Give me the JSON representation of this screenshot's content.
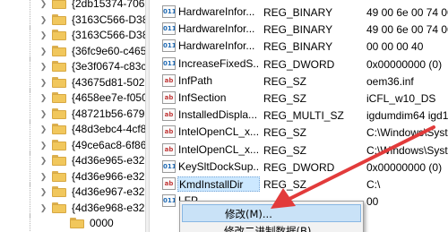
{
  "tree": {
    "items": [
      {
        "label": "{2db15374-706",
        "sub": false
      },
      {
        "label": "{3163C566-D38",
        "sub": false
      },
      {
        "label": "{3163C566-D38",
        "sub": false
      },
      {
        "label": "{36fc9e60-c465",
        "sub": false
      },
      {
        "label": "{3e3f0674-c83c",
        "sub": false
      },
      {
        "label": "{43675d81-502",
        "sub": false
      },
      {
        "label": "{4658ee7e-f050",
        "sub": false
      },
      {
        "label": "{48721b56-679",
        "sub": false
      },
      {
        "label": "{48d3ebc4-4cf8",
        "sub": false
      },
      {
        "label": "{49ce6ac8-6f86",
        "sub": false
      },
      {
        "label": "{4d36e965-e32",
        "sub": false
      },
      {
        "label": "{4d36e966-e32",
        "sub": false
      },
      {
        "label": "{4d36e967-e32",
        "sub": false
      },
      {
        "label": "{4d36e968-e32",
        "sub": false
      },
      {
        "label": "0000",
        "sub": true
      }
    ]
  },
  "values": {
    "rows": [
      {
        "name": "HardwareInfor...",
        "type": "REG_BINARY",
        "data": "49 00 6e 00 74 00",
        "icon": "bin"
      },
      {
        "name": "HardwareInfor...",
        "type": "REG_BINARY",
        "data": "49 00 6e 00 74 00",
        "icon": "bin"
      },
      {
        "name": "HardwareInfor...",
        "type": "REG_BINARY",
        "data": "00 00 00 40",
        "icon": "bin"
      },
      {
        "name": "IncreaseFixedS...",
        "type": "REG_DWORD",
        "data": "0x00000000 (0)",
        "icon": "bin"
      },
      {
        "name": "InfPath",
        "type": "REG_SZ",
        "data": "oem36.inf",
        "icon": "str"
      },
      {
        "name": "InfSection",
        "type": "REG_SZ",
        "data": "iCFL_w10_DS",
        "icon": "str"
      },
      {
        "name": "InstalledDispla...",
        "type": "REG_MULTI_SZ",
        "data": "igdumdim64 igd1",
        "icon": "str"
      },
      {
        "name": "IntelOpenCL_x...",
        "type": "REG_SZ",
        "data": "C:\\Windows\\Syste",
        "icon": "str"
      },
      {
        "name": "IntelOpenCL_x...",
        "type": "REG_SZ",
        "data": "C:\\Windows\\Syste",
        "icon": "str"
      },
      {
        "name": "KeySltDockSup...",
        "type": "REG_DWORD",
        "data": "0x00000000 (0)",
        "icon": "bin"
      },
      {
        "name": "KmdInstallDir",
        "type": "REG_SZ",
        "data": "C:\\",
        "icon": "str"
      },
      {
        "name": "LFP",
        "type": "",
        "data": "00",
        "icon": "bin"
      }
    ]
  },
  "context_menu": {
    "items": [
      {
        "label": "修改(M)..."
      },
      {
        "label": "修改二进制数据(B)..."
      }
    ]
  },
  "colors": {
    "annotation_arrow": "#e23b3b",
    "selection": "#cce8ff",
    "menu_hover": "#c9e2f7"
  }
}
